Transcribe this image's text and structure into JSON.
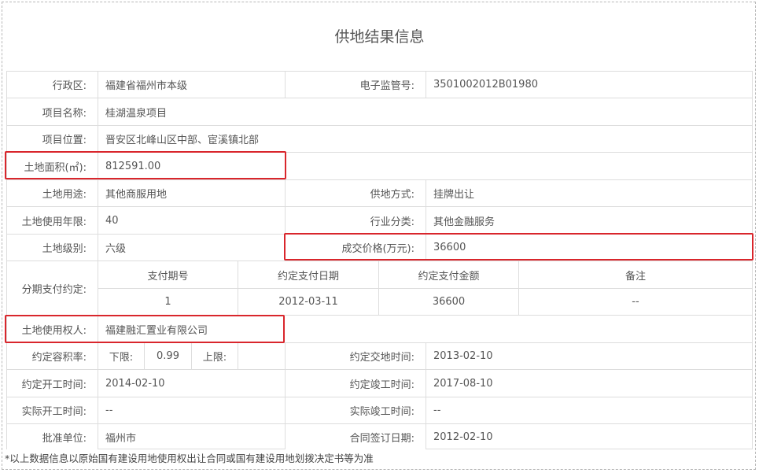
{
  "title": "供地结果信息",
  "fields": {
    "admin_region": {
      "label": "行政区:",
      "value": "福建省福州市本级"
    },
    "supervision_no": {
      "label": "电子监管号:",
      "value": "3501002012B01980"
    },
    "project_name": {
      "label": "项目名称:",
      "value": "桂湖温泉项目"
    },
    "project_location": {
      "label": "项目位置:",
      "value": "晋安区北峰山区中部、宦溪镇北部"
    },
    "land_area": {
      "label": "土地面积(㎡):",
      "value": "812591.00"
    },
    "land_use": {
      "label": "土地用途:",
      "value": "其他商服用地"
    },
    "supply_method": {
      "label": "供地方式:",
      "value": "挂牌出让"
    },
    "use_term": {
      "label": "土地使用年限:",
      "value": "40"
    },
    "industry": {
      "label": "行业分类:",
      "value": "其他金融服务"
    },
    "land_grade": {
      "label": "土地级别:",
      "value": "六级"
    },
    "deal_price": {
      "label": "成交价格(万元):",
      "value": "36600"
    },
    "installment": {
      "label": "分期支付约定:",
      "headers": [
        "支付期号",
        "约定支付日期",
        "约定支付金额",
        "备注"
      ],
      "row": [
        "1",
        "2012-03-11",
        "36600",
        "--"
      ]
    },
    "land_user": {
      "label": "土地使用权人:",
      "value": "福建融汇置业有限公司"
    },
    "plot_ratio": {
      "label": "约定容积率:",
      "lower_label": "下限:",
      "lower_value": "0.99",
      "upper_label": "上限:",
      "upper_value": ""
    },
    "handover_time": {
      "label": "约定交地时间:",
      "value": "2013-02-10"
    },
    "start_time": {
      "label": "约定开工时间:",
      "value": "2014-02-10"
    },
    "complete_time": {
      "label": "约定竣工时间:",
      "value": "2017-08-10"
    },
    "actual_start": {
      "label": "实际开工时间:",
      "value": "--"
    },
    "actual_complete": {
      "label": "实际竣工时间:",
      "value": "--"
    },
    "approval_unit": {
      "label": "批准单位:",
      "value": "福州市"
    },
    "contract_date": {
      "label": "合同签订日期:",
      "value": "2012-02-10"
    }
  },
  "footnote": "*以上数据信息以原始国有建设用地使用权出让合同或国有建设用地划拨决定书等为准",
  "colors": {
    "border": "#dddddd",
    "highlight": "#d9262c",
    "text": "#555555"
  }
}
